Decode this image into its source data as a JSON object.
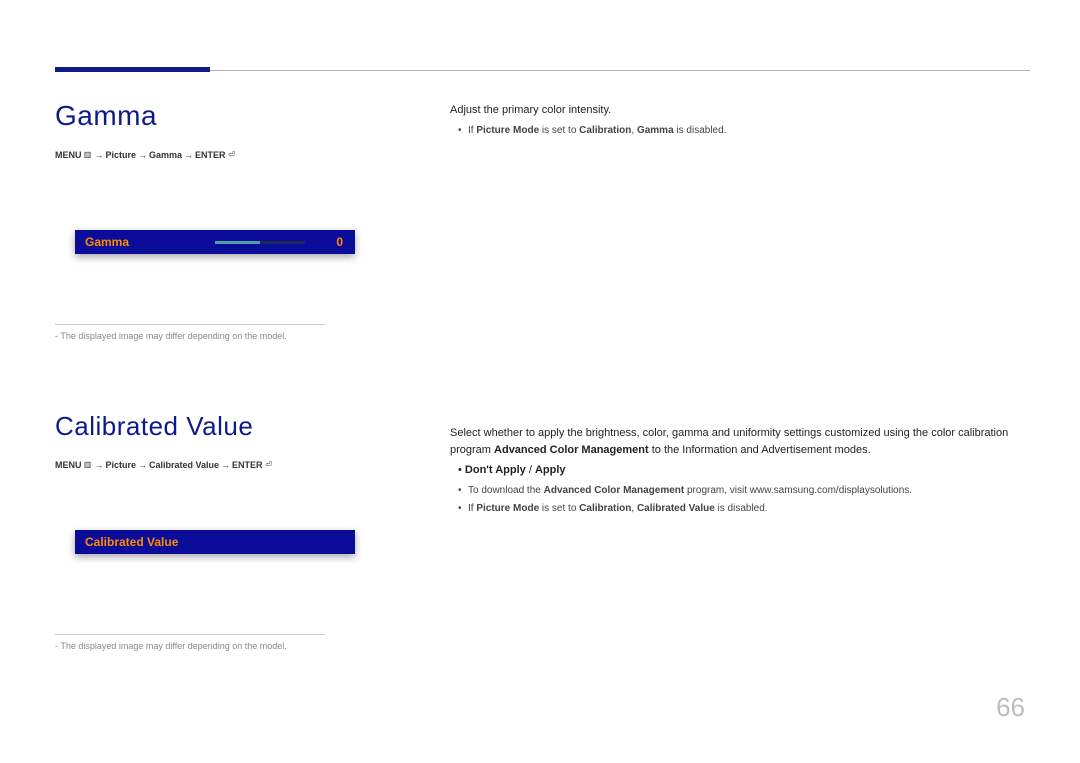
{
  "page_number": "66",
  "section1": {
    "title": "Gamma",
    "nav": {
      "prefix": "MENU",
      "p1": "Picture",
      "p2": "Gamma",
      "p3": "ENTER"
    },
    "ui_label": "Gamma",
    "ui_value": "0",
    "caption": "-  The displayed image may differ depending on the model.",
    "desc": "Adjust the primary color intensity.",
    "bullet1_pre": "If ",
    "bullet1_b1": "Picture Mode",
    "bullet1_mid": " is set to ",
    "bullet1_b2": "Calibration",
    "bullet1_post": ", ",
    "bullet1_b3": "Gamma",
    "bullet1_end": " is disabled."
  },
  "section2": {
    "title": "Calibrated Value",
    "nav": {
      "prefix": "MENU",
      "p1": "Picture",
      "p2": "Calibrated Value",
      "p3": "ENTER"
    },
    "ui_label": "Calibrated Value",
    "caption": "-  The displayed image may differ depending on the model.",
    "desc1": "Select whether to apply the brightness, color, gamma and uniformity settings customized using the color calibration program",
    "desc1_b": "Advanced Color Management",
    "desc1_end": " to the Information and Advertisement modes.",
    "options_pre": "• ",
    "options_b1": "Don't Apply",
    "options_mid": " / ",
    "options_b2": "Apply",
    "bullet1_pre": "To download the ",
    "bullet1_b1": "Advanced Color Management",
    "bullet1_post": " program, visit www.samsung.com/displaysolutions.",
    "bullet2_pre": "If ",
    "bullet2_b1": "Picture Mode",
    "bullet2_mid": " is set to ",
    "bullet2_b2": "Calibration",
    "bullet2_post": ", ",
    "bullet2_b3": "Calibrated Value",
    "bullet2_end": " is disabled."
  }
}
